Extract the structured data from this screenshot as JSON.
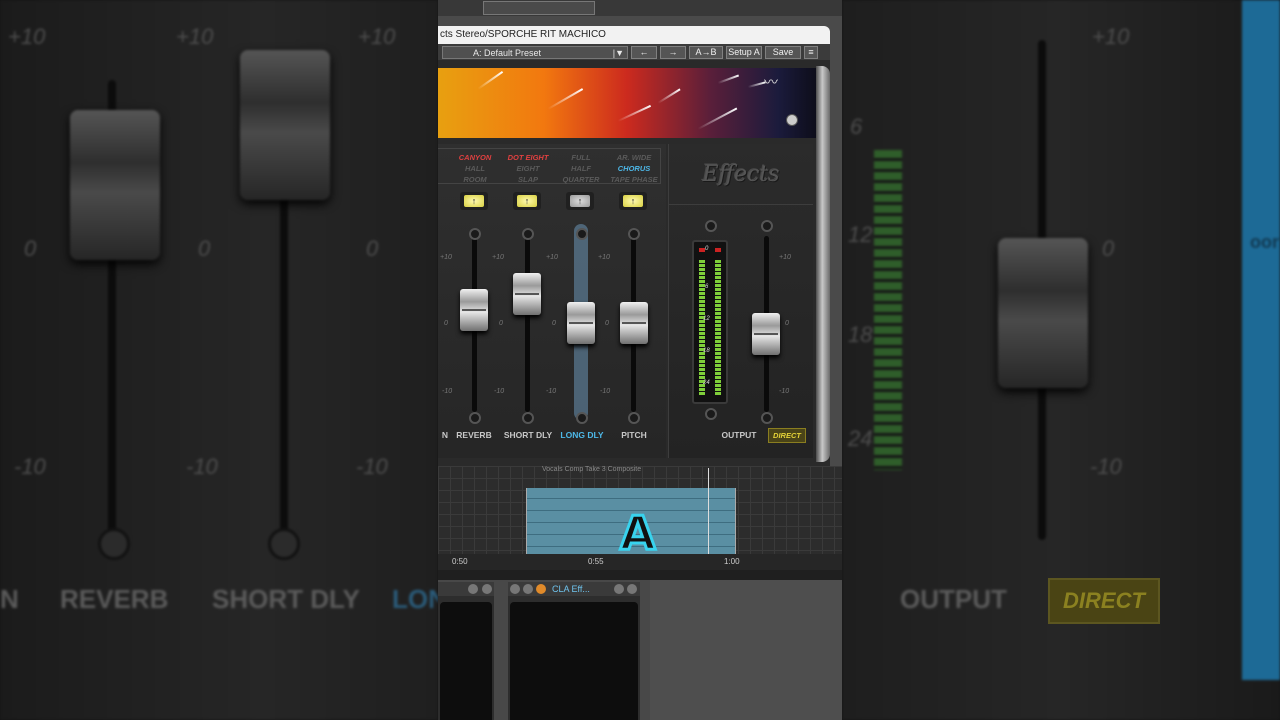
{
  "window": {
    "title": "cts Stereo/SPORCHE RIT MACHICO"
  },
  "toolbar": {
    "preset": "A: Default Preset",
    "preset_dropdown": "|▼",
    "prev": "←",
    "next": "→",
    "ab": "A→B",
    "setup": "Setup A",
    "save": "Save",
    "menu": "≡"
  },
  "plugin": {
    "logo": "Effects",
    "brand_mark": "〰",
    "modes": {
      "reverb_top": "CANYON",
      "reverb_mid": "HALL",
      "reverb_bot": "ROOM",
      "delay_top": "DOT EIGHT",
      "delay_mid": "EIGHT",
      "delay_bot": "SLAP",
      "long_top": "FULL",
      "long_mid": "HALF",
      "long_bot": "QUARTER",
      "pitch_top": "AR. WIDE",
      "pitch_mid": "CHORUS",
      "pitch_bot": "TAPE PHASE"
    },
    "channels": [
      {
        "label": "REVERB",
        "level": 0.62
      },
      {
        "label": "SHORT DLY",
        "level": 0.75
      },
      {
        "label": "LONG DLY",
        "level": 0.52
      },
      {
        "label": "PITCH",
        "level": 0.52
      }
    ],
    "partial_label": "N",
    "output": {
      "label": "OUTPUT",
      "level": 0.44
    },
    "direct": "DIRECT",
    "scale": {
      "p10": "+10",
      "zero": "0",
      "m10": "-10"
    },
    "meter": {
      "l0": "0",
      "l6": "6",
      "l12": "12",
      "l18": "18",
      "l24": "24"
    },
    "lamp_glyph": "↑",
    "colors": {
      "red": "#e04040",
      "blue": "#4db8e8",
      "inactive": "#5a5a5a"
    }
  },
  "timeline": {
    "clip_name": "Vocals Comp Take 3 Composite",
    "ruler": [
      "0:50",
      "0:55",
      "1:00"
    ],
    "marker": "A"
  },
  "mixer": {
    "insert_name": "CLA Eff..."
  },
  "background": {
    "left_labels": [
      "N",
      "REVERB",
      "SHORT DLY",
      "LON"
    ],
    "right_labels": [
      "OUTPUT"
    ],
    "direct": "DIRECT",
    "scale_plus": "+10",
    "scale_zero": "0",
    "scale_minus": "-10",
    "meter_0": "0",
    "meter_6": "6",
    "meter_12": "12",
    "meter_18": "18",
    "meter_24": "24",
    "boost": "oor"
  }
}
